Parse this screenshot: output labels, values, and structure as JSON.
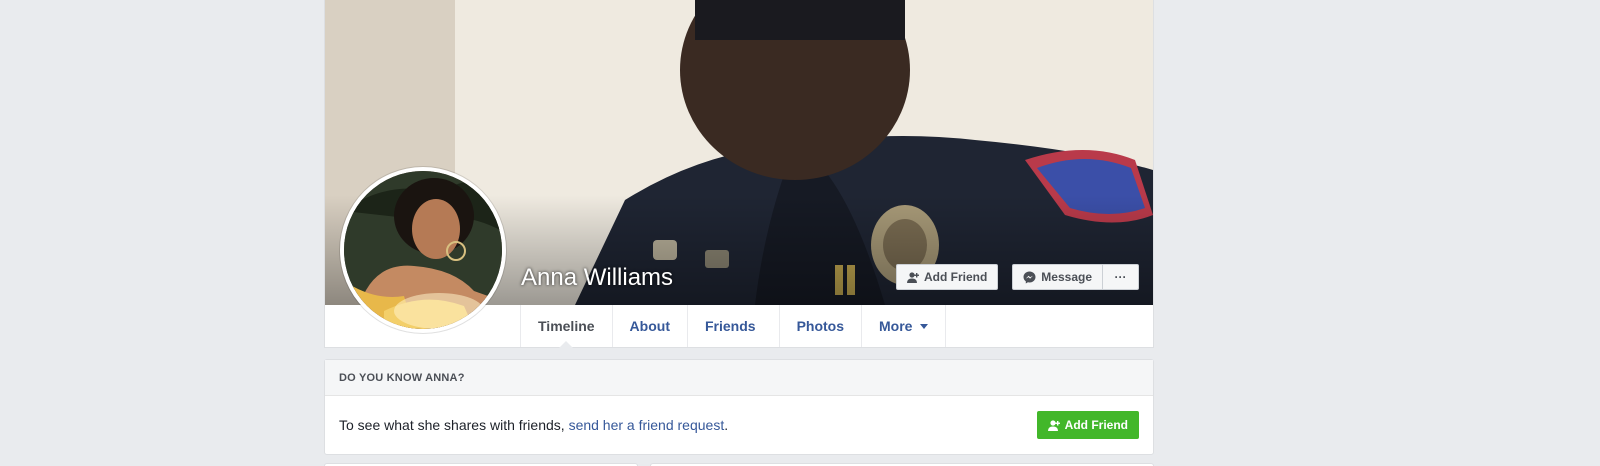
{
  "profile": {
    "name": "Anna Williams",
    "cover_alt": "cover-photo",
    "avatar_alt": "profile-picture"
  },
  "cover_actions": {
    "add_friend_label": "Add Friend",
    "message_label": "Message",
    "more_label": "···"
  },
  "tabs": [
    {
      "label": "Timeline",
      "active": true
    },
    {
      "label": "About"
    },
    {
      "label": "Friends"
    },
    {
      "label": "Photos"
    },
    {
      "label": "More"
    }
  ],
  "know_card": {
    "heading": "DO YOU KNOW ANNA?",
    "text_prefix": "To see what she shares with friends, ",
    "link_text": "send her a friend request",
    "text_suffix": ".",
    "button_label": "Add Friend"
  },
  "colors": {
    "page_bg": "#e9ebee",
    "link": "#365899",
    "green_button": "#42b72a"
  }
}
